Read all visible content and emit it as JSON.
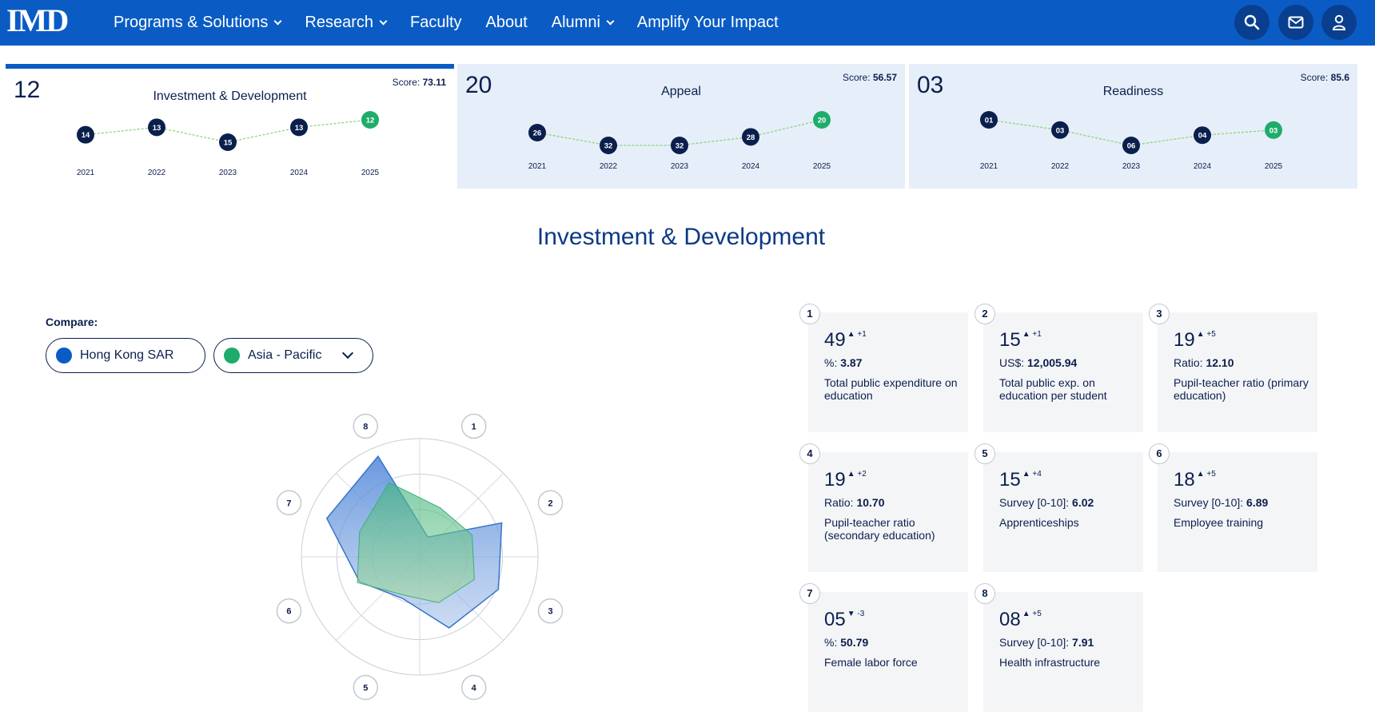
{
  "nav": {
    "logo": "IMD",
    "links": [
      {
        "label": "Programs & Solutions",
        "dropdown": true
      },
      {
        "label": "Research",
        "dropdown": true
      },
      {
        "label": "Faculty",
        "dropdown": false
      },
      {
        "label": "About",
        "dropdown": false
      },
      {
        "label": "Alumni",
        "dropdown": true
      },
      {
        "label": "Amplify Your Impact",
        "dropdown": false
      }
    ],
    "icons": [
      "search-icon",
      "mail-icon",
      "user-icon"
    ]
  },
  "rank_cards": [
    {
      "rank": "12",
      "title": "Investment & Development",
      "score_label": "Score:",
      "score": "73.11",
      "active": true,
      "years": [
        "2021",
        "2022",
        "2023",
        "2024",
        "2025"
      ],
      "ranks": [
        "14",
        "13",
        "15",
        "13",
        "12"
      ]
    },
    {
      "rank": "20",
      "title": "Appeal",
      "score_label": "Score:",
      "score": "56.57",
      "active": false,
      "years": [
        "2021",
        "2022",
        "2023",
        "2024",
        "2025"
      ],
      "ranks": [
        "26",
        "32",
        "32",
        "28",
        "20"
      ]
    },
    {
      "rank": "03",
      "title": "Readiness",
      "score_label": "Score:",
      "score": "85.6",
      "active": false,
      "years": [
        "2021",
        "2022",
        "2023",
        "2024",
        "2025"
      ],
      "ranks": [
        "01",
        "03",
        "06",
        "04",
        "03"
      ]
    }
  ],
  "section_title": "Investment & Development",
  "compare": {
    "label": "Compare:",
    "primary": {
      "name": "Hong Kong SAR",
      "color": "#0a5cc4"
    },
    "secondary": {
      "name": "Asia - Pacific",
      "color": "#1fac6b"
    }
  },
  "radar": {
    "axes": [
      "1",
      "2",
      "3",
      "4",
      "5",
      "6",
      "7",
      "8"
    ],
    "hong_kong": [
      0.18,
      0.75,
      0.72,
      0.65,
      0.38,
      0.55,
      0.85,
      0.92
    ],
    "asia_pacific": [
      0.45,
      0.48,
      0.5,
      0.42,
      0.35,
      0.57,
      0.55,
      0.68
    ]
  },
  "metrics": [
    {
      "num": "1",
      "rank": "49",
      "dir": "▲",
      "change": "+1",
      "unit": "%:",
      "value": "3.87",
      "name": "Total public expenditure on education"
    },
    {
      "num": "2",
      "rank": "15",
      "dir": "▲",
      "change": "+1",
      "unit": "US$:",
      "value": "12,005.94",
      "name": "Total public exp. on education per student"
    },
    {
      "num": "3",
      "rank": "19",
      "dir": "▲",
      "change": "+5",
      "unit": "Ratio:",
      "value": "12.10",
      "name": "Pupil-teacher ratio (primary education)"
    },
    {
      "num": "4",
      "rank": "19",
      "dir": "▲",
      "change": "+2",
      "unit": "Ratio:",
      "value": "10.70",
      "name": "Pupil-teacher ratio (secondary education)"
    },
    {
      "num": "5",
      "rank": "15",
      "dir": "▲",
      "change": "+4",
      "unit": "Survey [0-10]:",
      "value": "6.02",
      "name": "Apprenticeships"
    },
    {
      "num": "6",
      "rank": "18",
      "dir": "▲",
      "change": "+5",
      "unit": "Survey [0-10]:",
      "value": "6.89",
      "name": "Employee training"
    },
    {
      "num": "7",
      "rank": "05",
      "dir": "▼",
      "change": "-3",
      "unit": "%:",
      "value": "50.79",
      "name": "Female labor force"
    },
    {
      "num": "8",
      "rank": "08",
      "dir": "▲",
      "change": "+5",
      "unit": "Survey [0-10]:",
      "value": "7.91",
      "name": "Health infrastructure"
    }
  ]
}
